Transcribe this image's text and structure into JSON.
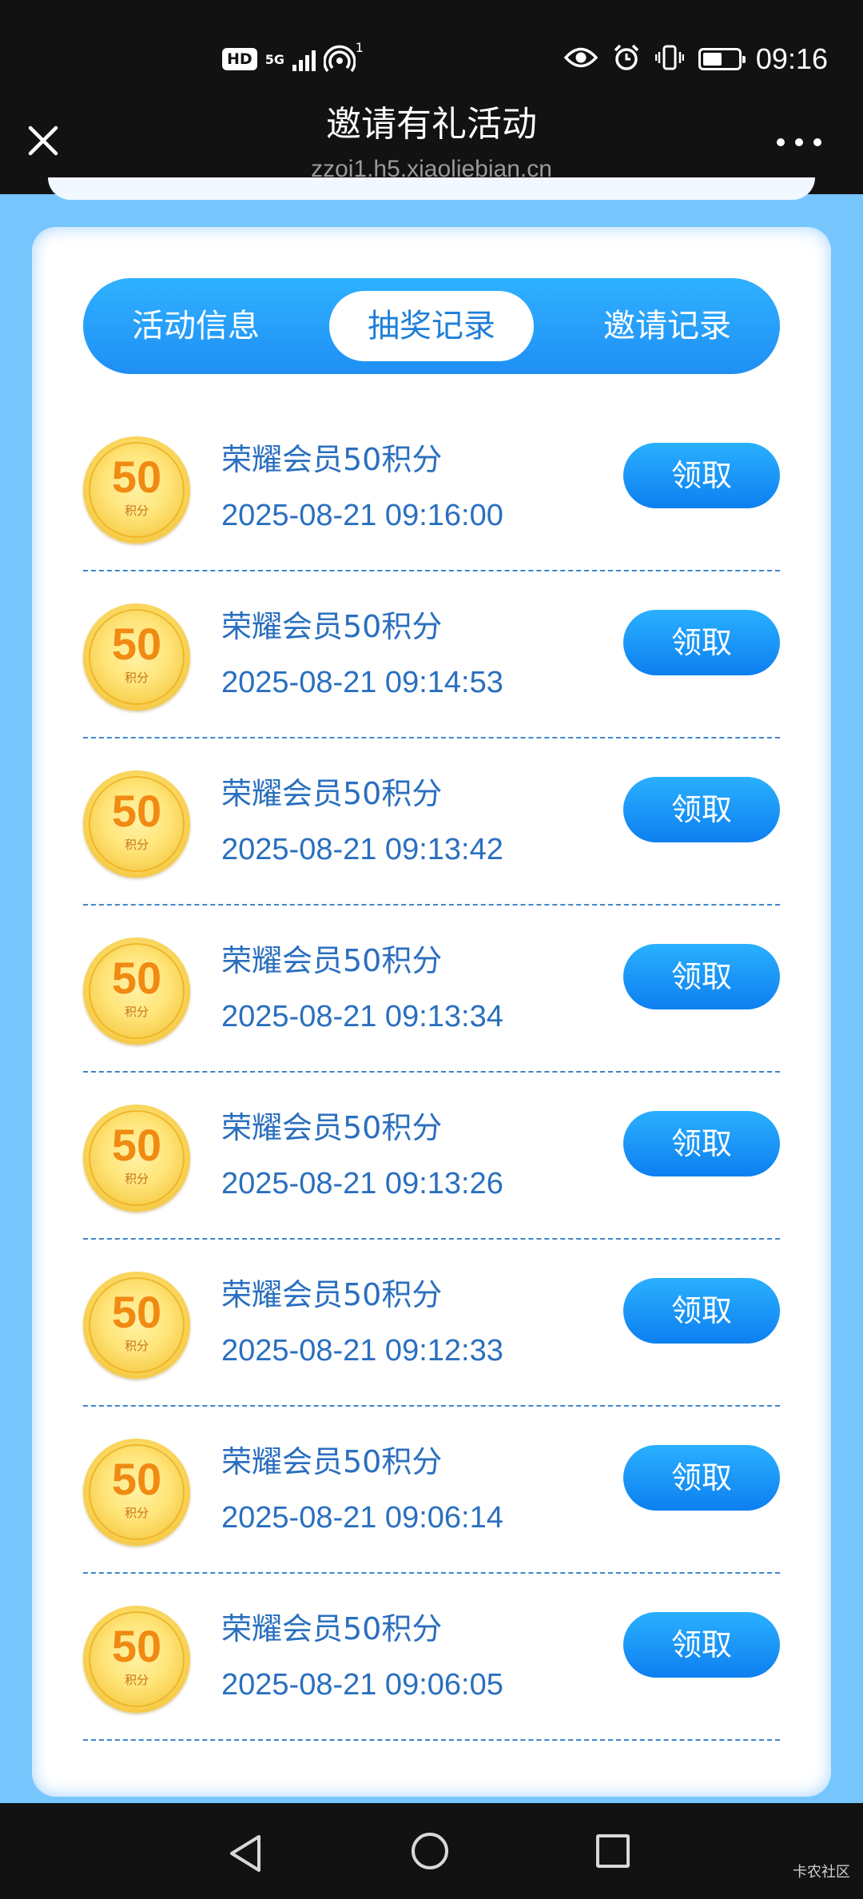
{
  "status_bar": {
    "hd": "HD",
    "network": "5G",
    "hotspot_count": "1",
    "battery_level": 0.55,
    "time": "09:16",
    "icons": [
      "eye-comfort-icon",
      "alarm-icon",
      "vibrate-icon",
      "battery-icon"
    ]
  },
  "header": {
    "title": "邀请有礼活动",
    "url": "zzoi1.h5.xiaoliebian.cn"
  },
  "tabs": [
    {
      "label": "活动信息",
      "active": false
    },
    {
      "label": "抽奖记录",
      "active": true
    },
    {
      "label": "邀请记录",
      "active": false
    }
  ],
  "records": [
    {
      "coin_value": "50",
      "coin_unit": "积分",
      "title": "荣耀会员50积分",
      "time": "2025-08-21 09:16:00",
      "action": "领取"
    },
    {
      "coin_value": "50",
      "coin_unit": "积分",
      "title": "荣耀会员50积分",
      "time": "2025-08-21 09:14:53",
      "action": "领取"
    },
    {
      "coin_value": "50",
      "coin_unit": "积分",
      "title": "荣耀会员50积分",
      "time": "2025-08-21 09:13:42",
      "action": "领取"
    },
    {
      "coin_value": "50",
      "coin_unit": "积分",
      "title": "荣耀会员50积分",
      "time": "2025-08-21 09:13:34",
      "action": "领取"
    },
    {
      "coin_value": "50",
      "coin_unit": "积分",
      "title": "荣耀会员50积分",
      "time": "2025-08-21 09:13:26",
      "action": "领取"
    },
    {
      "coin_value": "50",
      "coin_unit": "积分",
      "title": "荣耀会员50积分",
      "time": "2025-08-21 09:12:33",
      "action": "领取"
    },
    {
      "coin_value": "50",
      "coin_unit": "积分",
      "title": "荣耀会员50积分",
      "time": "2025-08-21 09:06:14",
      "action": "领取"
    },
    {
      "coin_value": "50",
      "coin_unit": "积分",
      "title": "荣耀会员50积分",
      "time": "2025-08-21 09:06:05",
      "action": "领取"
    }
  ],
  "watermark": "卡农社区",
  "colors": {
    "page_bg": "#76c6fd",
    "accent": "#1f8ff5",
    "text_blue": "#2a6fbf",
    "bar": "#121212"
  }
}
